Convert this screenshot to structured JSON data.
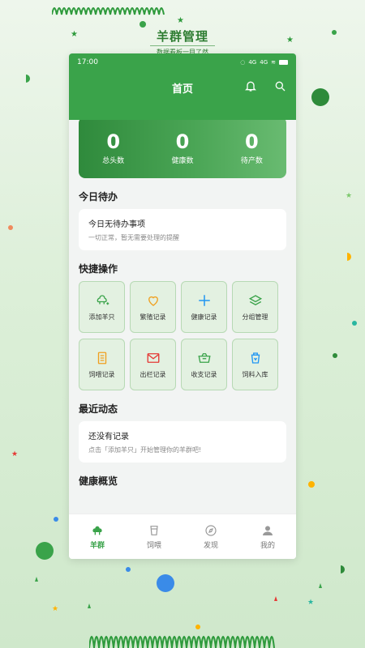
{
  "brand": {
    "title": "羊群管理",
    "subtitle": "数据看板一目了然"
  },
  "status_bar": {
    "time": "17:00",
    "signal": "4G",
    "signal2": "4G"
  },
  "header": {
    "title": "首页",
    "icons": [
      "bell-icon",
      "search-icon"
    ]
  },
  "stats": [
    {
      "value": "0",
      "label": "总头数"
    },
    {
      "value": "0",
      "label": "健康数"
    },
    {
      "value": "0",
      "label": "待产数"
    }
  ],
  "todo": {
    "section_title": "今日待办",
    "title": "今日无待办事项",
    "desc": "一切正常，暂无需要处理的提醒"
  },
  "quick": {
    "section_title": "快捷操作",
    "items": [
      {
        "label": "添加羊只",
        "icon": "sheep-add-icon",
        "color": "#3aa34a"
      },
      {
        "label": "繁殖记录",
        "icon": "heart-icon",
        "color": "#f0a020"
      },
      {
        "label": "健康记录",
        "icon": "plus-icon",
        "color": "#2196f3"
      },
      {
        "label": "分组管理",
        "icon": "layers-icon",
        "color": "#3aa34a"
      },
      {
        "label": "饲喂记录",
        "icon": "document-icon",
        "color": "#f0a020"
      },
      {
        "label": "出栏记录",
        "icon": "mail-icon",
        "color": "#e53935"
      },
      {
        "label": "收支记录",
        "icon": "basket-icon",
        "color": "#3aa34a"
      },
      {
        "label": "饲料入库",
        "icon": "bucket-icon",
        "color": "#2196f3"
      }
    ]
  },
  "recent": {
    "section_title": "最近动态",
    "title": "还没有记录",
    "desc": "点击「添加羊只」开始管理你的羊群吧!"
  },
  "health": {
    "section_title": "健康概览"
  },
  "tabs": [
    {
      "label": "羊群",
      "icon": "sheep-icon",
      "active": true
    },
    {
      "label": "饲喂",
      "icon": "cup-icon",
      "active": false
    },
    {
      "label": "发现",
      "icon": "compass-icon",
      "active": false
    },
    {
      "label": "我的",
      "icon": "user-icon",
      "active": false
    }
  ],
  "colors": {
    "primary": "#3aa34a",
    "background": "#f2f4f3"
  }
}
